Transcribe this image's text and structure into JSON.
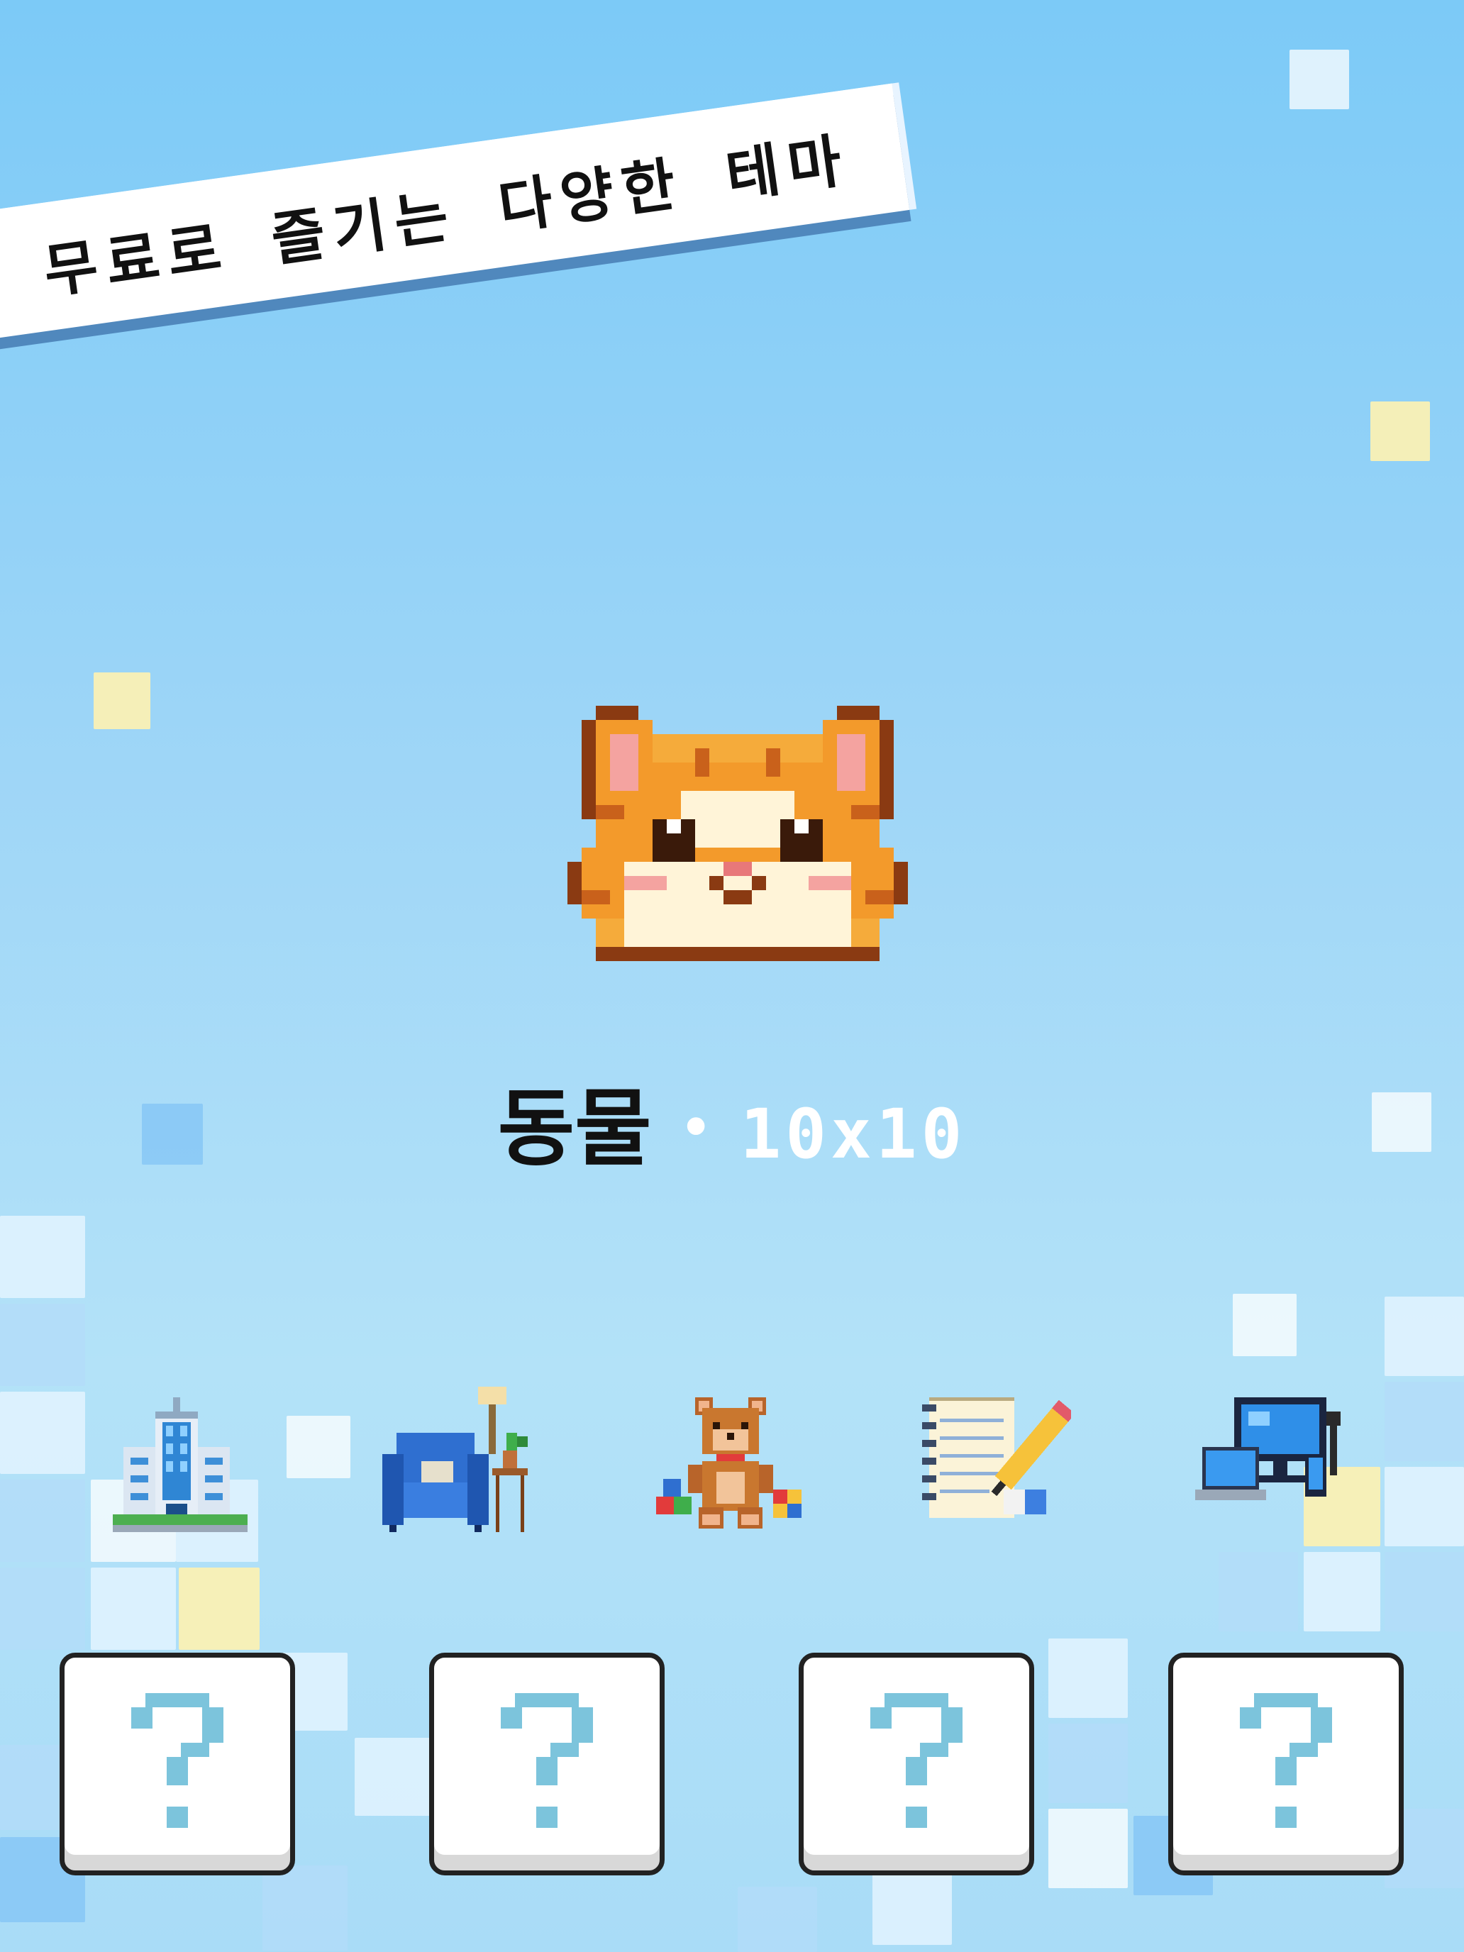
{
  "banner": {
    "text": "무료로 즐기는 다양한 테마"
  },
  "theme": {
    "name": "동물",
    "separator": "•",
    "size": "10x10"
  },
  "categories": [
    {
      "icon": "building-icon"
    },
    {
      "icon": "armchair-icon"
    },
    {
      "icon": "teddy-bear-icon"
    },
    {
      "icon": "notebook-pencil-icon"
    },
    {
      "icon": "computer-devices-icon"
    }
  ],
  "locked_slots": [
    {
      "label": "?"
    },
    {
      "label": "?"
    },
    {
      "label": "?"
    },
    {
      "label": "?"
    }
  ],
  "colors": {
    "background_top": "#7ccaf7",
    "banner_shadow": "#5088bd",
    "cat_orange": "#f39a2b",
    "question_mark": "#7cc4dc"
  }
}
